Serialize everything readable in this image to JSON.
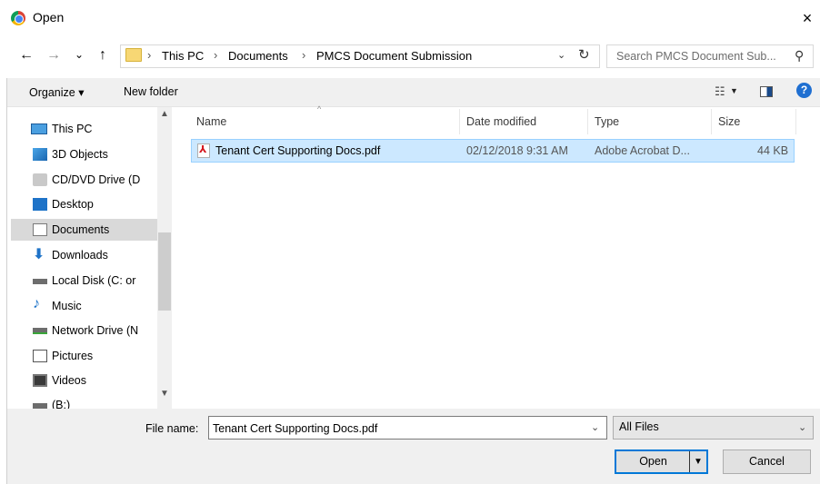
{
  "window": {
    "title": "Open",
    "app_icon": "chrome-icon",
    "close_label": "×"
  },
  "nav": {
    "back": "←",
    "forward": "→",
    "recent": "⌄",
    "up": "↑"
  },
  "breadcrumb": {
    "items": [
      "This PC",
      "Documents",
      "PMCS Document Submission"
    ],
    "separator": "›",
    "dropdown": "⌄",
    "refresh": "↻"
  },
  "search": {
    "placeholder": "Search PMCS Document Sub...",
    "icon": "search-icon"
  },
  "toolbar": {
    "organize_label": "Organize ▾",
    "new_folder_label": "New folder",
    "view_icon": "view-options-icon",
    "help_label": "?"
  },
  "sidebar": {
    "items": [
      {
        "label": "This PC",
        "icon": "computer-icon",
        "selected": false
      },
      {
        "label": "3D Objects",
        "icon": "3d-objects-icon",
        "selected": false
      },
      {
        "label": "CD/DVD Drive (D",
        "icon": "cd-drive-icon",
        "selected": false
      },
      {
        "label": "Desktop",
        "icon": "desktop-icon",
        "selected": false
      },
      {
        "label": "Documents",
        "icon": "documents-icon",
        "selected": true
      },
      {
        "label": "Downloads",
        "icon": "downloads-icon",
        "selected": false
      },
      {
        "label": "Local Disk (C: or",
        "icon": "local-disk-icon",
        "selected": false
      },
      {
        "label": "Music",
        "icon": "music-icon",
        "selected": false
      },
      {
        "label": "Network Drive (N",
        "icon": "network-drive-icon",
        "selected": false
      },
      {
        "label": "Pictures",
        "icon": "pictures-icon",
        "selected": false
      },
      {
        "label": "Videos",
        "icon": "videos-icon",
        "selected": false
      },
      {
        "label": "(B:)",
        "icon": "drive-icon",
        "selected": false
      }
    ]
  },
  "filelist": {
    "columns": {
      "name": "Name",
      "date": "Date modified",
      "type": "Type",
      "size": "Size"
    },
    "sort_caret": "^",
    "rows": [
      {
        "name": "Tenant Cert Supporting Docs.pdf",
        "date": "02/12/2018 9:31 AM",
        "type": "Adobe Acrobat D...",
        "size": "44 KB",
        "icon": "pdf-icon",
        "selected": true
      }
    ]
  },
  "footer": {
    "file_name_label": "File name:",
    "file_name_value": "Tenant Cert Supporting Docs.pdf",
    "file_type_value": "All Files",
    "open_label": "Open",
    "cancel_label": "Cancel"
  },
  "colors": {
    "selection_bg": "#cce8ff",
    "selection_border": "#99d1ff",
    "accent": "#0078d7",
    "help": "#1f6fd1"
  }
}
